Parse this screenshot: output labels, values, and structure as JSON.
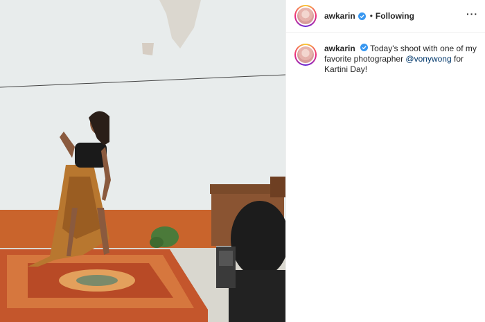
{
  "post": {
    "image_alt": "photo",
    "author": {
      "username": "awkarin",
      "verified": true,
      "follow_status": "Following",
      "separator": "•"
    },
    "more_icon": "more-options-icon",
    "caption": {
      "username": "awkarin",
      "text_1": "Today's shoot with one of my favorite photographer",
      "mention": "@vonywong",
      "text_2": "for Kartini Day!"
    }
  },
  "colors": {
    "verified": "#3897f0",
    "mention": "#00376b",
    "text": "#262626"
  }
}
